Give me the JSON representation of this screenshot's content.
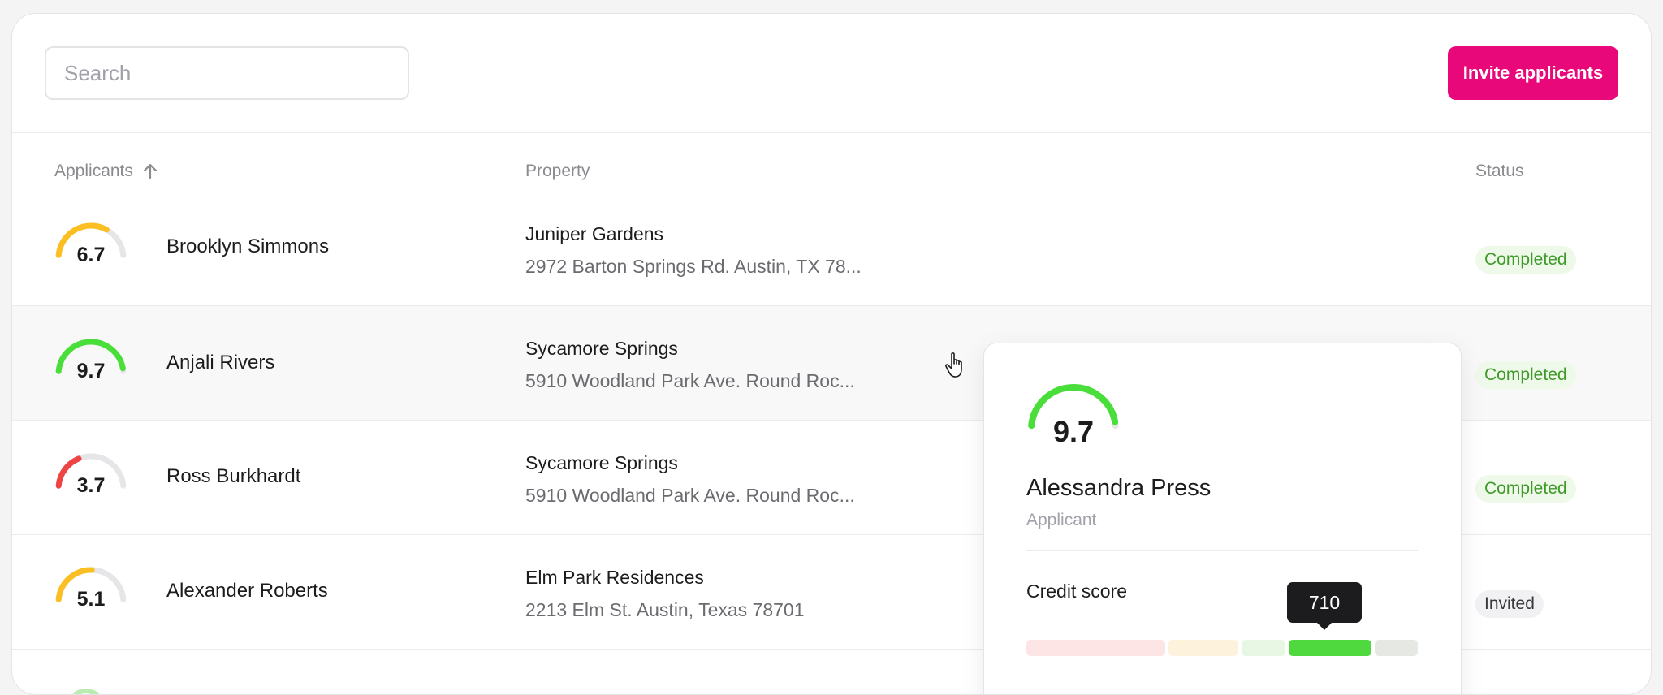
{
  "toolbar": {
    "search_placeholder": "Search",
    "invite_label": "Invite applicants",
    "accent_color": "#e8087a"
  },
  "table": {
    "columns": {
      "applicants": "Applicants",
      "property": "Property",
      "status": "Status"
    },
    "sort_icon": "arrow-up-icon",
    "rows": [
      {
        "score": "6.7",
        "score_value": 6.7,
        "gauge_color": "#fbbf24",
        "name": "Brooklyn Simmons",
        "property": "Juniper Gardens",
        "address": "2972 Barton Springs Rd. Austin, TX 78...",
        "status": "Completed"
      },
      {
        "score": "9.7",
        "score_value": 9.7,
        "gauge_color": "#4ade3a",
        "name": "Anjali Rivers",
        "property": "Sycamore Springs",
        "address": "5910 Woodland Park Ave. Round Roc...",
        "status": "Completed"
      },
      {
        "score": "3.7",
        "score_value": 3.7,
        "gauge_color": "#ef4444",
        "name": "Ross Burkhardt",
        "property": "Sycamore Springs",
        "address": "5910 Woodland Park Ave. Round Roc...",
        "status": "Completed"
      },
      {
        "score": "5.1",
        "score_value": 5.1,
        "gauge_color": "#fbbf24",
        "name": "Alexander Roberts",
        "property": "Elm Park Residences",
        "address": "2213 Elm St. Austin, Texas 78701",
        "status": "Invited"
      }
    ]
  },
  "popover": {
    "score": "9.7",
    "score_value": 9.7,
    "gauge_color": "#4ade3a",
    "name": "Alessandra Press",
    "role": "Applicant",
    "credit_label": "Credit score",
    "credit_value": "710"
  },
  "colors": {
    "completed_bg": "#eef9ea",
    "completed_text": "#3f9a2a",
    "invited_bg": "#f1f1f3",
    "gauge_track": "#e6e6e8"
  },
  "cursor_icon": "hand-pointer-icon"
}
